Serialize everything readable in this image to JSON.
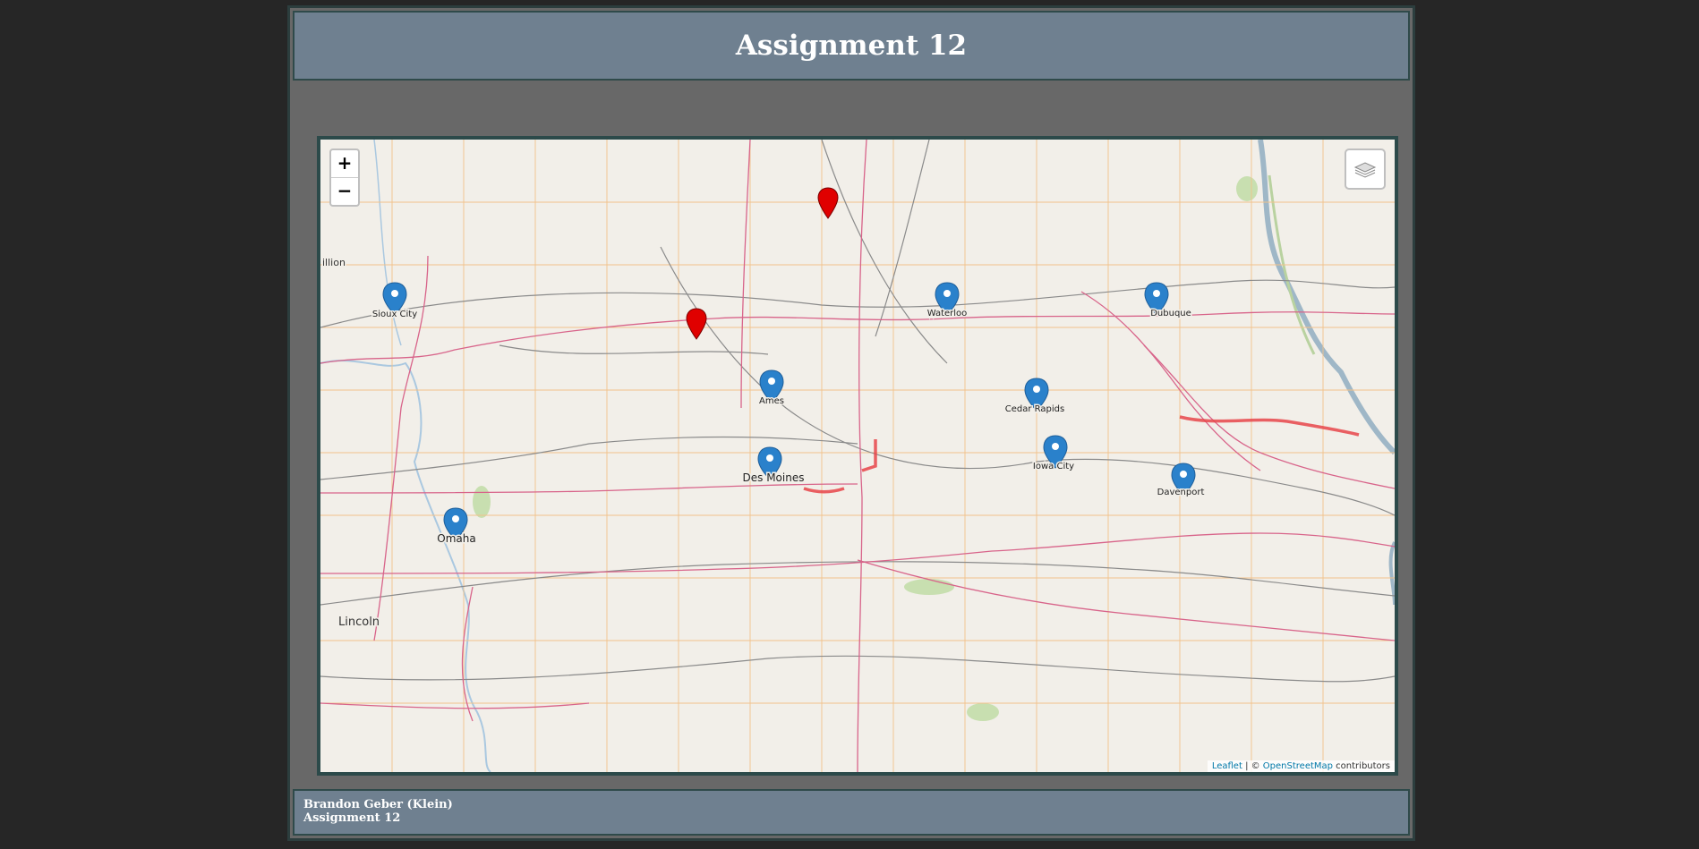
{
  "header": {
    "title": "Assignment 12"
  },
  "map": {
    "zoom_in_label": "+",
    "zoom_out_label": "−",
    "layers_icon": "layers-icon",
    "attribution": {
      "leaflet_link": "Leaflet",
      "separator": " | © ",
      "osm_link": "OpenStreetMap",
      "suffix": " contributors"
    },
    "base_labels": {
      "vermillion": "illion",
      "lincoln": "Lincoln"
    },
    "blue_markers": [
      {
        "label": "Sioux City"
      },
      {
        "label": "Waterloo"
      },
      {
        "label": "Dubuque"
      },
      {
        "label": "Ames"
      },
      {
        "label": "Cedar Rapids"
      },
      {
        "label": "Iowa City"
      },
      {
        "label": "Des Moines"
      },
      {
        "label": "Davenport"
      },
      {
        "label": "Omaha"
      }
    ],
    "red_markers": [
      {
        "name": "red-marker-north"
      },
      {
        "name": "red-marker-west-central"
      }
    ],
    "colors": {
      "blue_marker": "#2a81cb",
      "red_marker": "#e00000",
      "route_highlight": "#e8454a"
    }
  },
  "footer": {
    "line1": "Brandon Geber (Klein)",
    "line2": "Assignment 12"
  }
}
